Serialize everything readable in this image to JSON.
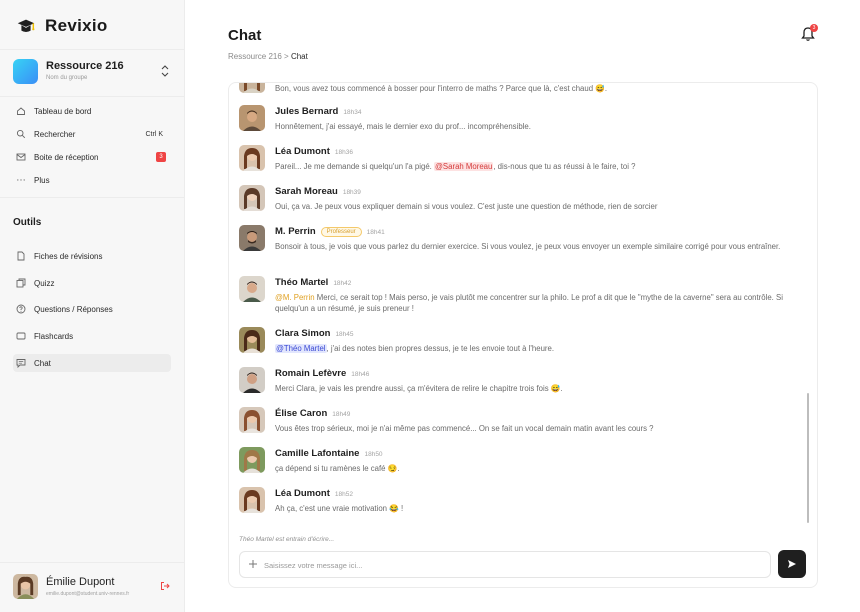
{
  "brand": {
    "name": "Revixio"
  },
  "resource": {
    "name": "Ressource 216",
    "subtitle": "Nom du groupe"
  },
  "nav": [
    {
      "label": "Tableau de bord",
      "icon": "home-icon"
    },
    {
      "label": "Rechercher",
      "icon": "search-icon",
      "shortcut": "Ctrl K"
    },
    {
      "label": "Boite de réception",
      "icon": "inbox-icon",
      "badge": "3"
    },
    {
      "label": "Plus",
      "icon": "more-icon"
    }
  ],
  "tools": {
    "title": "Outils",
    "items": [
      {
        "label": "Fiches de révisions",
        "icon": "file-icon"
      },
      {
        "label": "Quizz",
        "icon": "quiz-icon"
      },
      {
        "label": "Questions / Réponses",
        "icon": "question-icon"
      },
      {
        "label": "Flashcards",
        "icon": "flashcards-icon"
      },
      {
        "label": "Chat",
        "icon": "chat-icon",
        "active": true
      }
    ]
  },
  "user": {
    "name": "Émilie Dupont",
    "email": "emilie.dupont@student.univ-rennes.fr"
  },
  "header": {
    "title": "Chat",
    "breadcrumb_parent": "Ressource 216",
    "breadcrumb_sep": ">",
    "breadcrumb_current": "Chat",
    "notification_count": "3"
  },
  "messages": [
    {
      "name": "",
      "time": "",
      "text": "Bon, vous avez tous commencé à bosser pour l'interro de maths ? Parce que là, c'est chaud 😅."
    },
    {
      "name": "Jules Bernard",
      "time": "18h34",
      "text": "Honnêtement, j'ai essayé, mais le dernier exo du prof... incompréhensible."
    },
    {
      "name": "Léa Dumont",
      "time": "18h36",
      "text_before": "Pareil... Je me demande si quelqu'un l'a pigé. ",
      "mention": "@Sarah Moreau",
      "text_after": ", dis-nous que tu as réussi à le faire, toi ?"
    },
    {
      "name": "Sarah Moreau",
      "time": "18h39",
      "text": "Oui, ça va. Je peux vous expliquer demain si vous voulez. C'est juste une question de méthode, rien de sorcier"
    },
    {
      "name": "M. Perrin",
      "role": "Professeur",
      "time": "18h41",
      "text": "Bonsoir à tous, je vois que vous parlez du dernier exercice. Si vous voulez, je peux vous envoyer un exemple similaire corrigé pour vous entraîner."
    },
    {
      "name": "Théo Martel",
      "time": "18h42",
      "mention": "@M. Perrin",
      "text_after": " Merci, ce serait top ! Mais perso, je vais plutôt me concentrer sur la philo. Le prof a dit que le \"mythe de la caverne\" sera au contrôle. Si quelqu'un a un résumé, je suis preneur !"
    },
    {
      "name": "Clara Simon",
      "time": "18h45",
      "mention": "@Théo Martel",
      "text_after": ", j'ai des notes bien propres dessus, je te les envoie tout à l'heure."
    },
    {
      "name": "Romain Lefèvre",
      "time": "18h46",
      "text": "Merci Clara, je vais les prendre aussi, ça m'évitera de relire le chapitre trois fois 😅."
    },
    {
      "name": "Élise Caron",
      "time": "18h49",
      "text": "Vous êtes trop sérieux, moi je n'ai même pas commencé... On se fait un vocal demain matin avant les cours ?"
    },
    {
      "name": "Camille Lafontaine",
      "time": "18h50",
      "text": "ça dépend si tu ramènes le café 😏."
    },
    {
      "name": "Léa Dumont",
      "time": "18h52",
      "text": "Ah ça, c'est une vraie motivation 😂 !"
    }
  ],
  "typing": "Théo Martel est entrain d'écrire...",
  "composer": {
    "placeholder": "Saisissez votre message ici..."
  },
  "colors": {
    "accent": "#1f1f1f",
    "badge": "#ef4444",
    "mention_red": "#d43a3a",
    "mention_blue": "#3b4ad4",
    "professor_tag": "#d69e2e"
  }
}
